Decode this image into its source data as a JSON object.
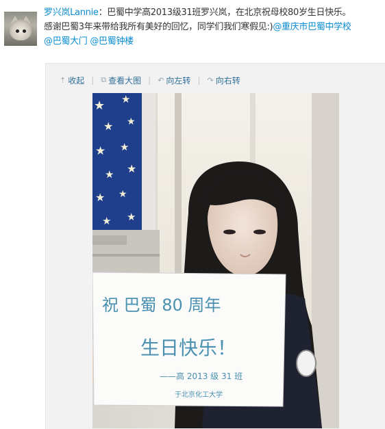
{
  "post": {
    "author": "罗兴岚Lannie",
    "line1_rest": "：巴蜀中学高2013级31班罗兴岚，在北京祝母校80岁生日快乐。",
    "line2_text": "感谢巴蜀3年来带给我所有美好的回忆，同学们我们寒假见:)",
    "mention1": "@重庆市巴蜀中学校",
    "mention2": "@巴蜀大门",
    "mention3": "@巴蜀钟楼"
  },
  "toolbar": {
    "collapse_label": "收起",
    "view_large_label": "查看大图",
    "rotate_left_label": "向左转",
    "rotate_right_label": "向右转",
    "collapse_icon": "up-arrow-icon",
    "view_large_icon": "external-view-icon",
    "rotate_left_icon": "rotate-left-icon",
    "rotate_right_icon": "rotate-right-icon"
  },
  "card": {
    "line1": "祝  巴蜀    80 周年",
    "line2": "生日快乐！",
    "line3": "——高 2013 级 31 班",
    "line4": "于北京化工大学"
  },
  "colors": {
    "link": "#0a8cd2",
    "toolbar_text": "#2f6f9a",
    "media_bg": "#f2f2f2",
    "curtain_blue": "#1f3e8c",
    "card_ink": "#4a90b0"
  }
}
